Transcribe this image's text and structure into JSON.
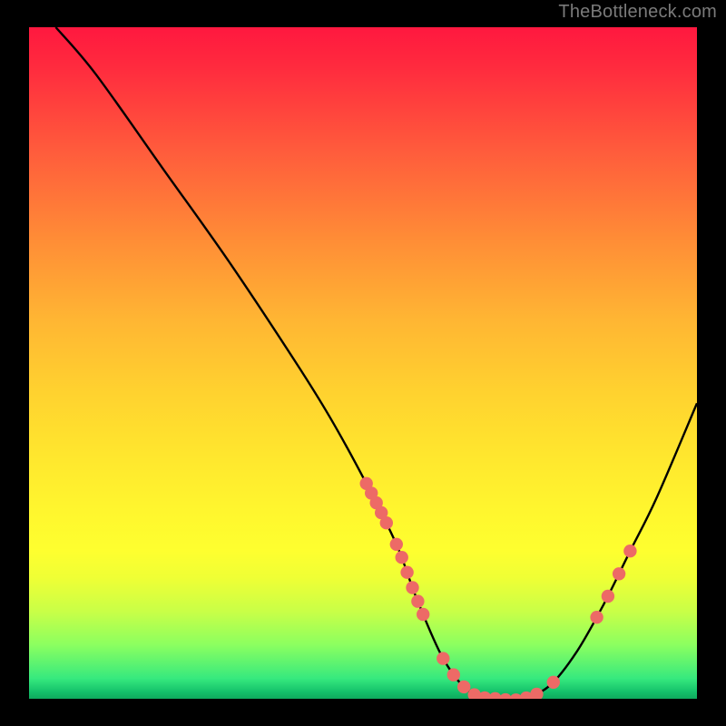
{
  "attribution": "TheBottleneck.com",
  "chart_data": {
    "type": "line",
    "title": "",
    "xlabel": "",
    "ylabel": "",
    "xlim": [
      0,
      100
    ],
    "ylim": [
      0,
      100
    ],
    "curve": {
      "x": [
        4,
        10,
        20,
        30,
        40,
        45,
        50,
        55,
        58,
        62,
        66,
        70,
        74,
        78,
        82,
        86,
        90,
        94,
        100
      ],
      "y": [
        100,
        93,
        79,
        65,
        50,
        42,
        33,
        23,
        15,
        6,
        1,
        0,
        0,
        2,
        7,
        14,
        22,
        30,
        44
      ]
    },
    "dot_clusters": [
      {
        "x_range": [
          50.5,
          53.5
        ],
        "y_range": [
          21,
          27
        ],
        "count": 5
      },
      {
        "x_range": [
          55,
          59
        ],
        "y_range": [
          9,
          18
        ],
        "count": 6
      },
      {
        "x_range": [
          62,
          76
        ],
        "y_range": [
          0,
          3
        ],
        "count": 10
      },
      {
        "x_range": [
          78,
          79
        ],
        "y_range": [
          2,
          3
        ],
        "count": 1
      },
      {
        "x_range": [
          85,
          90
        ],
        "y_range": [
          12,
          22
        ],
        "count": 4
      }
    ],
    "colors": {
      "curve_stroke": "#000000",
      "dot_fill": "#ed6a66",
      "gradient_top": "#ff183f",
      "gradient_bottom": "#0fa95d"
    }
  }
}
